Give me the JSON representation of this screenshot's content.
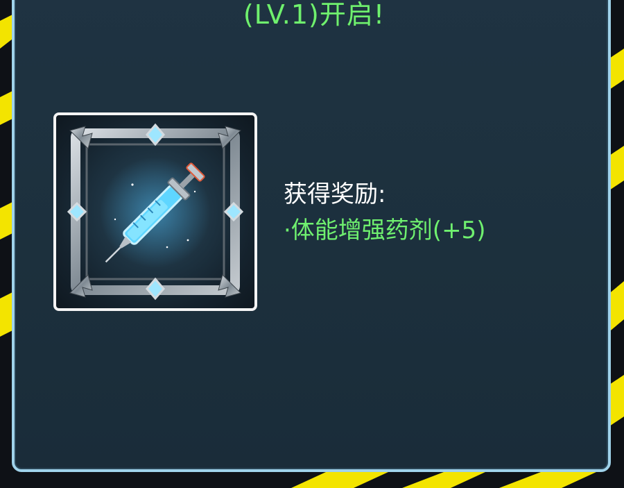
{
  "header": {
    "title": "(LV.1)开启!"
  },
  "reward": {
    "label": "获得奖励:",
    "item": "·体能增强药剂(+5)",
    "item_icon": "syringe-icon"
  },
  "colors": {
    "panel_bg": "#1f3342",
    "panel_border": "#9fd2ea",
    "accent_green": "#6ff06f",
    "warning_yellow": "#f3e400"
  }
}
